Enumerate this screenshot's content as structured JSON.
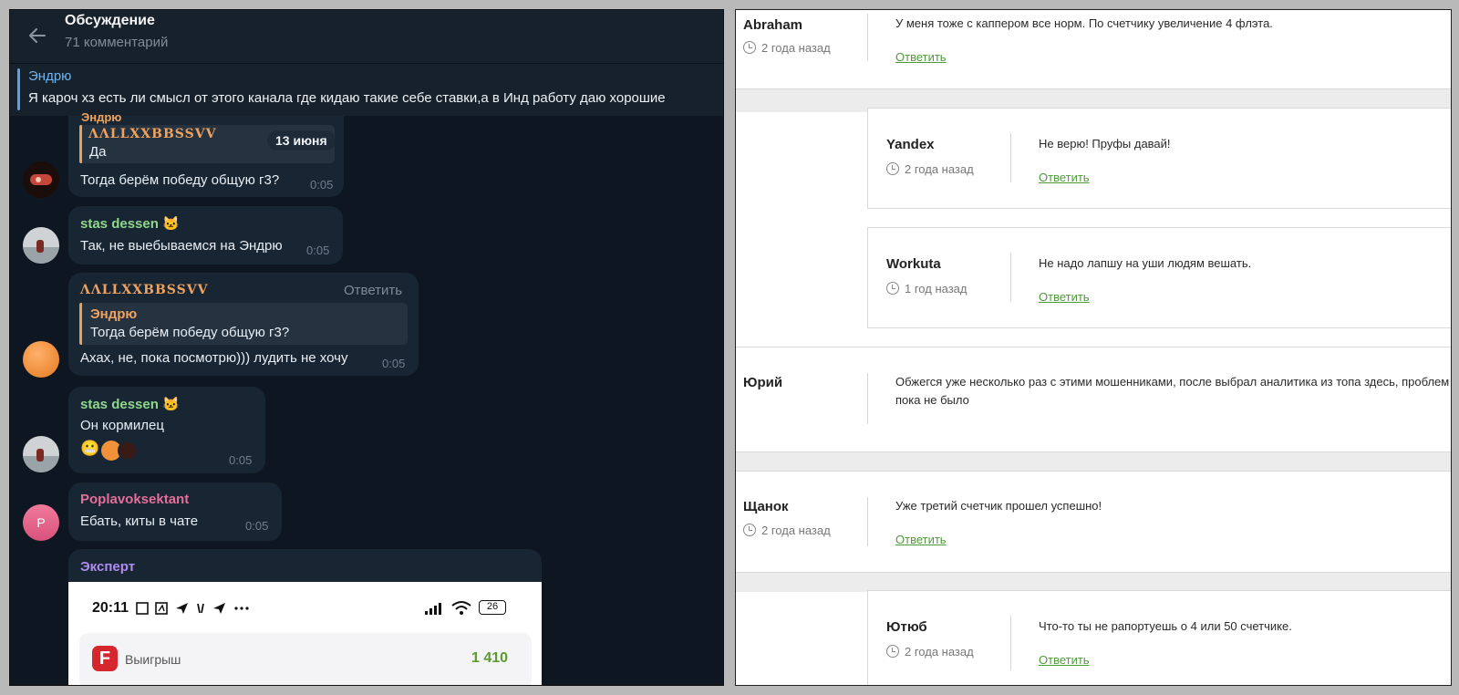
{
  "telegram": {
    "header": {
      "title": "Обсуждение",
      "subtitle": "71 комментарий"
    },
    "pinned": {
      "author": "Эндрю",
      "text": "Я кароч хз есть ли смысл от этого канала где кидаю такие себе ставки,а в Инд работу даю хорошие"
    },
    "date_badge": "13 июня",
    "messages": [
      {
        "author": "Эндрю",
        "quote_author": "ΛΛLLXXBBSSVV",
        "quote_text": "Да",
        "text": "Тогда берём победу общую г3?",
        "time": "0:05"
      },
      {
        "author": "stas dessen 🐱",
        "text": "Так, не выебываемся на Эндрю",
        "time": "0:05"
      },
      {
        "author": "ΛΛLLXXBBSSVV",
        "action": "Ответить",
        "quote_author": "Эндрю",
        "quote_text": "Тогда берём победу общую г3?",
        "text": "Ахах, не, пока посмотрю))) лудить не хочу",
        "time": "0:05"
      },
      {
        "author": "stas dessen 🐱",
        "text": "Он кормилец",
        "reactions": "😬",
        "time": "0:05"
      },
      {
        "author": "Poplavoksektant",
        "avatar_letter": "P",
        "text": "Ебать, киты в чате",
        "time": "0:05"
      },
      {
        "author": "Эксперт"
      }
    ],
    "phone": {
      "time": "20:11",
      "battery": "26",
      "card_label": "Выигрыш",
      "card_value": "1 410"
    }
  },
  "comments": [
    {
      "author": "Abraham",
      "age": "2 года назад",
      "text": "У меня тоже с каппером все норм. По счетчику увеличение 4 флэта.",
      "reply": "Ответить"
    },
    {
      "author": "Yandex",
      "age": "2 года назад",
      "text": "Не верю! Пруфы давай!",
      "reply": "Ответить"
    },
    {
      "author": "Workuta",
      "age": "1 год назад",
      "text": "Не надо лапшу на уши людям вешать.",
      "reply": "Ответить"
    },
    {
      "author": "Юрий",
      "text": "Обжегся уже несколько раз с этими мошенниками, после выбрал аналитика из топа здесь, проблем пока не было"
    },
    {
      "author": "Щанок",
      "age": "2 года назад",
      "text": "Уже третий счетчик прошел успешно!",
      "reply": "Ответить"
    },
    {
      "author": "Ютюб",
      "age": "2 года назад",
      "text": "Что-то ты не рапортуешь о 4 или 50 счетчике.",
      "reply": "Ответить"
    }
  ],
  "colors": {
    "tg_bg": "#0e1621",
    "bubble": "#182533",
    "link_green": "#4f9a3a",
    "accent_blue": "#5ca3e6",
    "name_green": "#8fd88a",
    "name_pink": "#e46f9a",
    "name_purple": "#b18cf0"
  }
}
